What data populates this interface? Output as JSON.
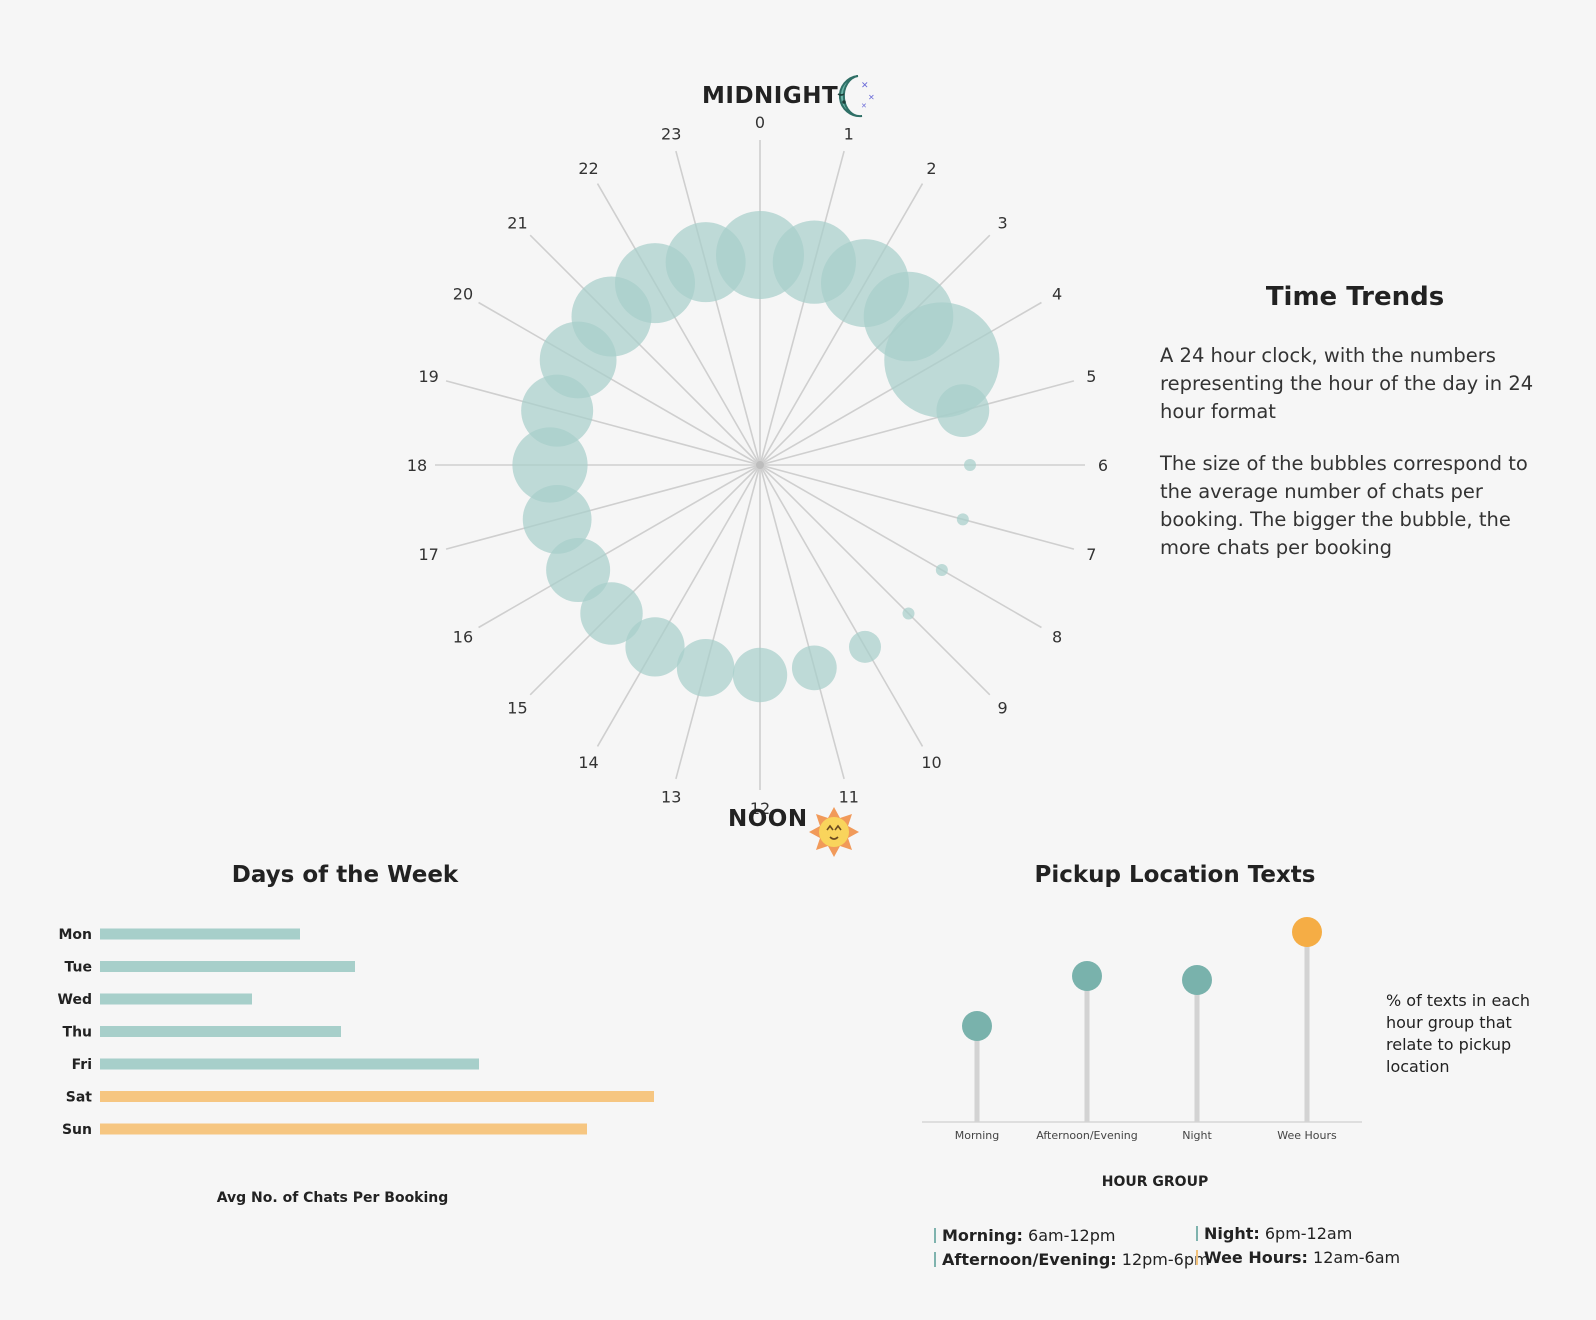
{
  "clock": {
    "top_label": "MIDNIGHT",
    "bottom_label": "NOON",
    "top_icon": "moon-icon",
    "bottom_icon": "sun-icon"
  },
  "time_trends": {
    "title": "Time Trends",
    "p1": "A 24 hour clock, with the numbers representing the hour of the day in 24 hour format",
    "p2": "The size of the bubbles correspond to the average number of chats per booking. The bigger the bubble, the more chats per booking"
  },
  "days": {
    "title": "Days of the Week",
    "xlabel": "Avg No. of Chats Per Booking"
  },
  "pickup": {
    "title": "Pickup Location Texts",
    "xlabel": "HOUR GROUP",
    "note": "% of texts in each hour group that relate to pickup location"
  },
  "legend": [
    {
      "name": "Morning:",
      "range": "6am-12pm",
      "color": "#7fb3ae"
    },
    {
      "name": "Afternoon/Evening:",
      "range": "12pm-6pm",
      "color": "#7fb3ae"
    },
    {
      "name": "Night:",
      "range": "6pm-12am",
      "color": "#7fb3ae"
    },
    {
      "name": "Wee Hours:",
      "range": "12am-6am",
      "color": "#f3c27b"
    }
  ],
  "colors": {
    "teal": "#7fb3ae",
    "bubble": "#a7cfca",
    "orange": "#f6c681",
    "lolly_teal": "#79b2ac",
    "lolly_orange": "#f5ad45"
  },
  "chart_data": [
    {
      "type": "scatter",
      "hours": [
        0,
        1,
        2,
        3,
        4,
        5,
        6,
        7,
        8,
        9,
        10,
        11,
        12,
        13,
        14,
        15,
        16,
        17,
        18,
        19,
        20,
        21,
        22,
        23
      ],
      "values": [
        55,
        52,
        55,
        56,
        72,
        33,
        5,
        5,
        6,
        1,
        20,
        28,
        34,
        36,
        37,
        39,
        40,
        43,
        47,
        45,
        48,
        50,
        50,
        50
      ]
    },
    {
      "type": "bar",
      "categories": [
        "Mon",
        "Tue",
        "Wed",
        "Thu",
        "Fri",
        "Sat",
        "Sun"
      ],
      "values": [
        2.0,
        2.55,
        1.52,
        2.41,
        3.79,
        5.54,
        4.87
      ],
      "highlight": [
        false,
        false,
        false,
        false,
        false,
        true,
        true
      ]
    },
    {
      "type": "bar",
      "categories": [
        "Morning",
        "Afternoon/Evening",
        "Night",
        "Wee Hours"
      ],
      "values": [
        0.48,
        0.73,
        0.71,
        0.95
      ],
      "highlight": [
        false,
        false,
        false,
        true
      ]
    }
  ]
}
